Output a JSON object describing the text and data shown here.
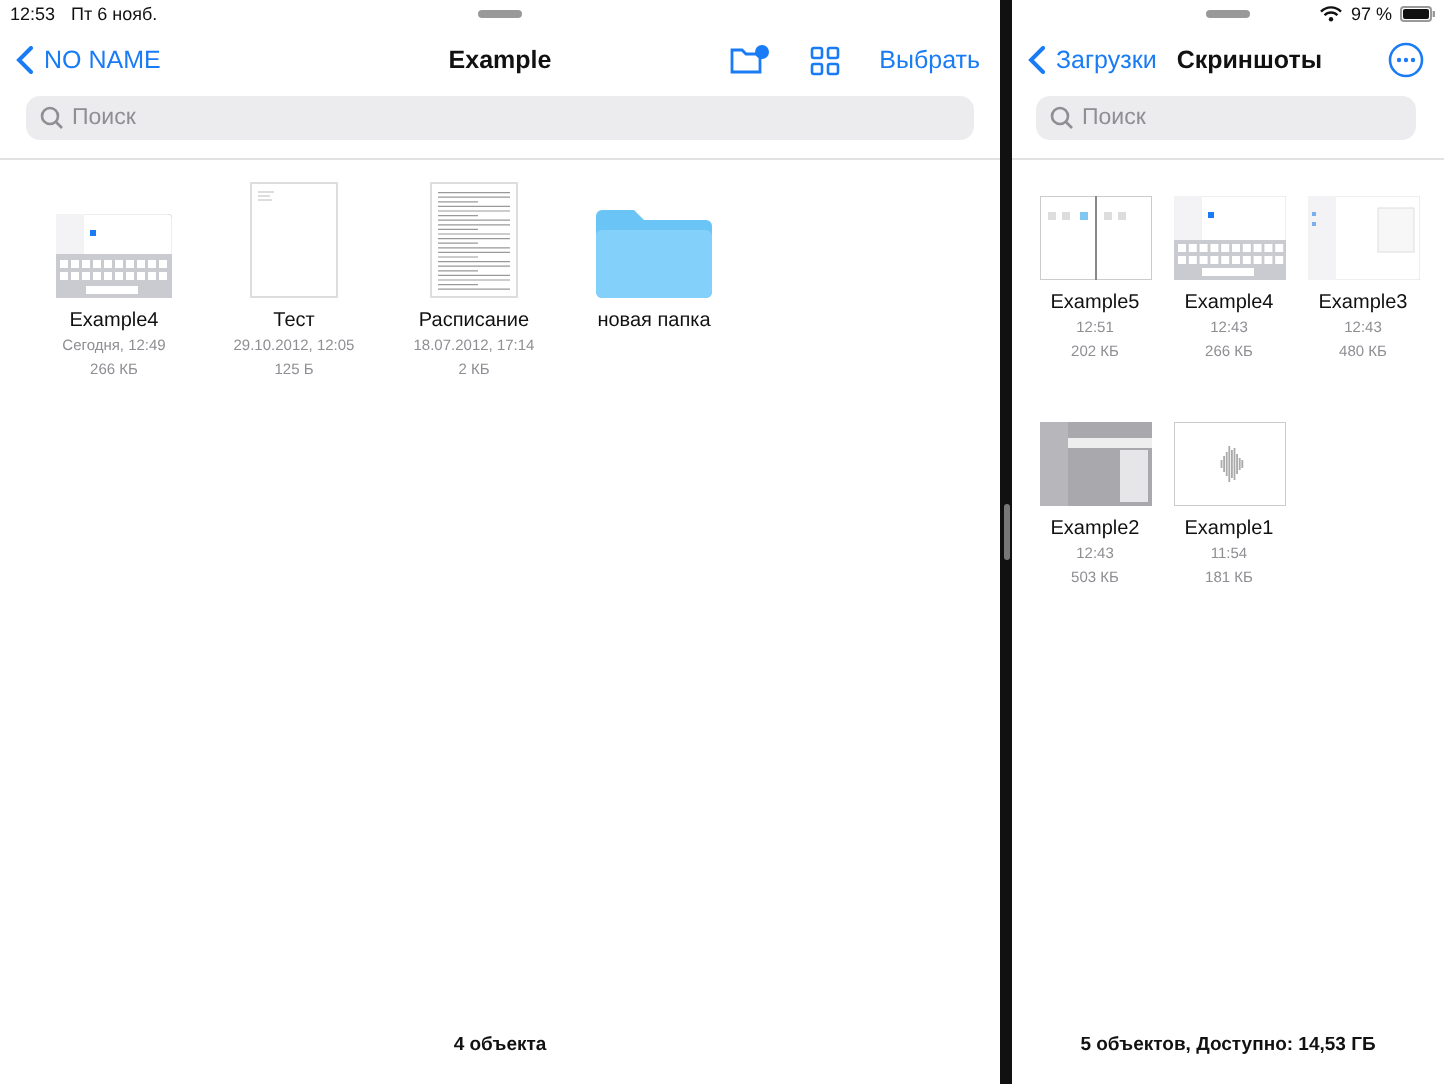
{
  "status_bar": {
    "time": "12:53",
    "date": "Пт 6 нояб.",
    "battery": "97 %"
  },
  "left_pane": {
    "back": "NO NAME",
    "title": "Example",
    "select": "Выбрать",
    "search": {
      "placeholder": "Поиск"
    },
    "items": [
      {
        "kind": "keyboard",
        "name": "Example4",
        "date": "Сегодня, 12:49",
        "size": "266 КБ"
      },
      {
        "kind": "blank-doc",
        "name": "Тест",
        "date": "29.10.2012, 12:05",
        "size": "125 Б"
      },
      {
        "kind": "text-doc",
        "name": "Расписание",
        "date": "18.07.2012, 17:14",
        "size": "2 КБ"
      },
      {
        "kind": "folder",
        "name": "новая папка"
      }
    ],
    "footer": "4 объекта"
  },
  "right_pane": {
    "back": "Загрузки",
    "title": "Скриншоты",
    "search": {
      "placeholder": "Поиск"
    },
    "items": [
      {
        "kind": "split",
        "name": "Example5",
        "date": "12:51",
        "size": "202 КБ"
      },
      {
        "kind": "keyboard",
        "name": "Example4",
        "date": "12:43",
        "size": "266 КБ"
      },
      {
        "kind": "panel",
        "name": "Example3",
        "date": "12:43",
        "size": "480 КБ"
      },
      {
        "kind": "dim-panel",
        "name": "Example2",
        "date": "12:43",
        "size": "503 КБ"
      },
      {
        "kind": "waveform",
        "name": "Example1",
        "date": "11:54",
        "size": "181 КБ"
      }
    ],
    "footer": "5 объектов, Доступно: 14,53 ГБ"
  }
}
